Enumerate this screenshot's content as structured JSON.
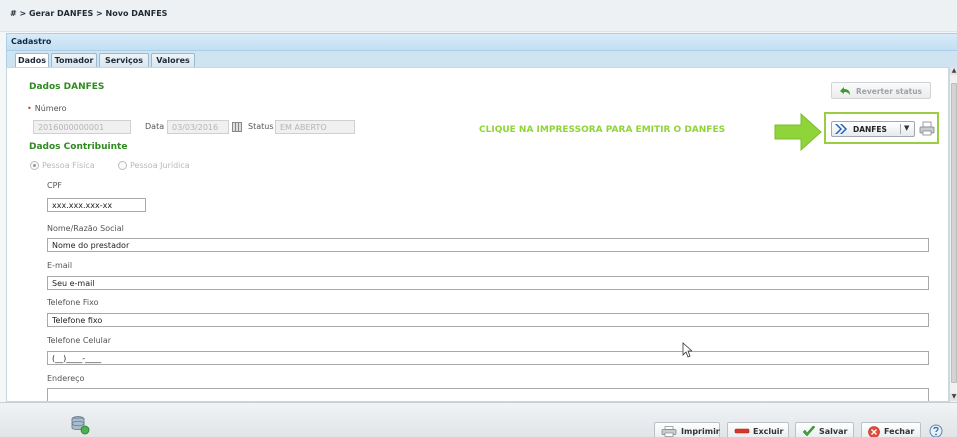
{
  "breadcrumb": "# > Gerar DANFES > Novo DANFES",
  "panel_title": "Cadastro",
  "tabs": [
    {
      "label": "Dados"
    },
    {
      "label": "Tomador"
    },
    {
      "label": "Serviços"
    },
    {
      "label": "Valores"
    }
  ],
  "dados_danfes": {
    "title": "Dados DANFES",
    "numero_label": "Número",
    "numero_value": "2016000000001",
    "data_label": "Data",
    "data_value": "03/03/2016",
    "status_label": "Status",
    "status_value": "EM ABERTO"
  },
  "reverter_button": "Reverter status",
  "hint_text": "CLIQUE NA IMPRESSORA PARA EMITIR O DANFES",
  "danfes_button": "DANFES",
  "dados_contribuinte": {
    "title": "Dados Contribuinte",
    "radio_fisica": "Pessoa Física",
    "radio_juridica": "Pessoa Jurídica",
    "cpf_label": "CPF",
    "cpf_value": "xxx.xxx.xxx-xx",
    "nome_label": "Nome/Razão Social",
    "nome_value": "Nome do prestador",
    "email_label": "E-mail",
    "email_value": "Seu e-mail",
    "telfixo_label": "Telefone Fixo",
    "telfixo_value": "Telefone fixo",
    "telcel_label": "Telefone Celular",
    "telcel_value": "(__)____-____",
    "endereco_label": "Endereço",
    "endereco_value": ""
  },
  "footer_buttons": {
    "imprimir": "Imprimir",
    "excluir": "Excluir",
    "salvar": "Salvar",
    "fechar": "Fechar"
  },
  "colors": {
    "section_green": "#2e8b1f",
    "hint_green": "#8fd438",
    "header_blue": "#c3dff2"
  }
}
